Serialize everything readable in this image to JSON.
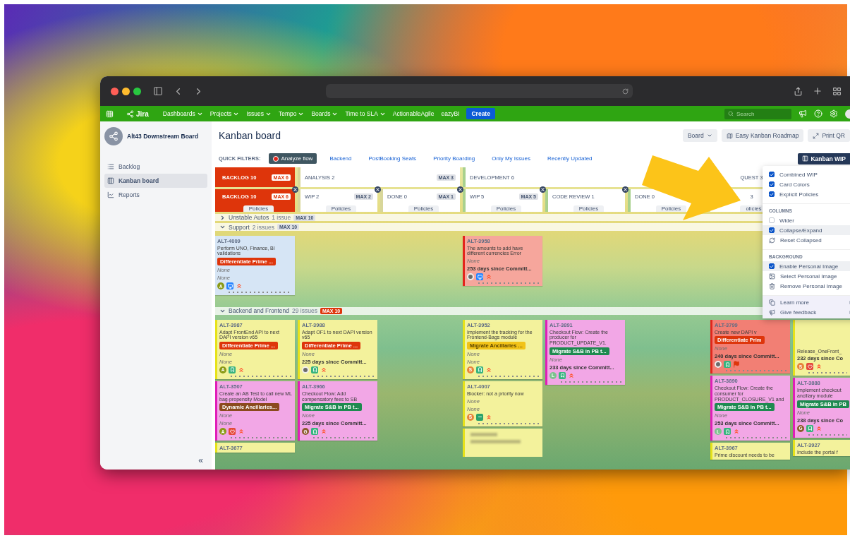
{
  "nav": {
    "product": "Jira",
    "items": [
      {
        "label": "Dashboards",
        "dropdown": true
      },
      {
        "label": "Projects",
        "dropdown": true
      },
      {
        "label": "Issues",
        "dropdown": true
      },
      {
        "label": "Tempo",
        "dropdown": true
      },
      {
        "label": "Boards",
        "dropdown": true
      },
      {
        "label": "Time to SLA",
        "dropdown": true
      },
      {
        "label": "ActionableAgile",
        "dropdown": false
      },
      {
        "label": "eazyBI",
        "dropdown": false
      }
    ],
    "create": "Create",
    "search": {
      "placeholder": "Search"
    }
  },
  "sidebar": {
    "project": "Alt43 Downstream Board",
    "items": [
      {
        "label": "Backlog",
        "kind": "backlog",
        "selected": false
      },
      {
        "label": "Kanban board",
        "kind": "board",
        "selected": true
      },
      {
        "label": "Reports",
        "kind": "reports",
        "selected": false
      }
    ],
    "collapse": "«"
  },
  "header": {
    "title": "Kanban board",
    "buttons": [
      {
        "label": "Board",
        "kind": "menu"
      },
      {
        "label": "Easy Kanban Roadmap",
        "kind": "roadmap"
      },
      {
        "label": "Print QR",
        "kind": "expand"
      }
    ]
  },
  "quick_filters": {
    "label": "QUICK FILTERS:",
    "items": [
      {
        "label": "Analyze flow",
        "selected": true
      },
      {
        "label": "Backend",
        "selected": false
      },
      {
        "label": "PostBooking Seats",
        "selected": false
      },
      {
        "label": "Priority Boarding",
        "selected": false
      },
      {
        "label": "Only My Issues",
        "selected": false
      },
      {
        "label": "Recently Updated",
        "selected": false
      }
    ],
    "wip_button": "Kanban WIP"
  },
  "groups": [
    {
      "label": "BACKLOG 10",
      "max": "MAX 6",
      "kind": "backlog",
      "color": "#de350b",
      "children": [
        {
          "label": "BACKLOG 10",
          "max": "MAX 6",
          "policies": "Policies",
          "collapsible": true
        }
      ]
    },
    {
      "label": "ANALYSIS 2",
      "max": "MAX 3",
      "kind": "normal",
      "color": "#d8d69a",
      "children": [
        {
          "label": "WIP 2",
          "max": "MAX 2",
          "policies": "Policies",
          "collapsible": true
        },
        {
          "label": "DONE 0",
          "max": "MAX 1",
          "policies": "Policies",
          "collapsible": true
        }
      ]
    },
    {
      "label": "DEVELOPMENT 6",
      "kind": "normal",
      "color": "#a9d18e",
      "children": [
        {
          "label": "WIP 5",
          "max": "MAX 5",
          "policies": "Policies",
          "collapsible": true
        },
        {
          "label": "CODE REVIEW 1",
          "policies": "Policies",
          "collapsible": true
        },
        {
          "label": "DONE 0",
          "policies": "Policies",
          "collapsible": true
        }
      ]
    },
    {
      "label": "QUEST 3",
      "kind": "cut",
      "children": [
        {
          "label": "3",
          "policies": "olicies",
          "collapsible": false
        }
      ]
    }
  ],
  "lanes": [
    {
      "name": "Unstable Autos",
      "count": "1 issue",
      "max": "MAX 10",
      "max_exceeded": false,
      "expanded": false
    },
    {
      "name": "Support",
      "count": "2 issues",
      "max": "MAX 10",
      "max_exceeded": false,
      "expanded": true,
      "cells": [
        [
          {
            "kind": "card",
            "key": "ALT-4009",
            "summary": "Perform UNO, Finance, BI validations",
            "epic": {
              "label": "Differentiate Prime ...",
              "color": "#de350b"
            },
            "fields": [
              "None",
              "None"
            ],
            "avatar": {
              "kind": "letter",
              "letter": "A",
              "color": "#8a9a16"
            },
            "issue_type": {
              "kind": "task"
            },
            "priority": {
              "kind": "highest"
            },
            "color": "#d6e5f5"
          }
        ],
        [],
        [],
        [
          {
            "kind": "card",
            "key": "ALT-3958",
            "summary": "The amounts to add have different currencies Error",
            "fields": [
              "None"
            ],
            "days": "253 days since Committ...",
            "avatar": {
              "kind": "photo"
            },
            "issue_type": {
              "kind": "task"
            },
            "priority": {
              "kind": "highest"
            },
            "color": "#f6a69c",
            "stripe": {
              "color": "#e3261c"
            }
          }
        ],
        [],
        [],
        [],
        []
      ]
    },
    {
      "name": "Backend and Frontend",
      "count": "29 issues",
      "max": "MAX 10",
      "max_exceeded": true,
      "expanded": true,
      "cells": [
        [
          {
            "kind": "card",
            "key": "ALT-3987",
            "summary": "Adapt FrontEnd API to next DAPI version v65",
            "epic": {
              "label": "Differentiate Prime ...",
              "color": "#de350b"
            },
            "fields": [
              "None",
              "None"
            ],
            "avatar": {
              "kind": "letter",
              "letter": "A",
              "color": "#8a9a16"
            },
            "issue_type": {
              "kind": "story"
            },
            "priority": {
              "kind": "highest"
            },
            "color": "#f3f29c",
            "stripe": {
              "color": "#e6e21a"
            }
          },
          {
            "kind": "card",
            "key": "ALT-3507",
            "summary": "Create an AB Test to call new ML bag-propensity Model",
            "epic": {
              "label": "Dynamic Ancillaries...",
              "color": "#8b4a1e"
            },
            "fields": [
              "None",
              "None"
            ],
            "avatar": {
              "kind": "letter",
              "letter": "A",
              "color": "#8a9a16"
            },
            "issue_type": {
              "kind": "bug"
            },
            "priority": {
              "kind": "highest"
            },
            "color": "#f2a7e6",
            "stripe": {
              "color": "#e01eb8"
            }
          },
          {
            "kind": "card",
            "key": "ALT-3677",
            "color": "#f3f29c",
            "stripe": {
              "color": "#e6e21a"
            }
          }
        ],
        [
          {
            "kind": "card",
            "key": "ALT-3988",
            "summary": "Adapt OF1 to next DAPI version v65",
            "epic": {
              "label": "Differentiate Prime ...",
              "color": "#de350b"
            },
            "fields": [
              "None"
            ],
            "days": "225 days since Committ...",
            "avatar": {
              "kind": "photo"
            },
            "issue_type": {
              "kind": "story"
            },
            "priority": {
              "kind": "highest"
            },
            "color": "#f3f29c",
            "stripe": {
              "color": "#e6e21a"
            }
          },
          {
            "kind": "card",
            "key": "ALT-3966",
            "summary": "Checkout Flow: Add compensatory fees to SB",
            "epic": {
              "label": "Migrate S&B in PB t...",
              "color": "#1e8a50"
            },
            "fields": [
              "None"
            ],
            "days": "225 days since Committ...",
            "avatar": {
              "kind": "letter",
              "letter": "G",
              "color": "#8b5a2b"
            },
            "issue_type": {
              "kind": "story"
            },
            "priority": {
              "kind": "highest"
            },
            "color": "#f2a7e6",
            "stripe": {
              "color": "#e01eb8"
            }
          }
        ],
        [],
        [
          {
            "kind": "card",
            "key": "ALT-3952",
            "summary": "Implement the tracking for the Frontend-Bags module",
            "epic": {
              "label": "Migrate Ancillaries ...",
              "color": "#f2c318"
            },
            "fields": [
              "None",
              "None"
            ],
            "avatar": {
              "kind": "letter",
              "letter": "S",
              "color": "#e8843a"
            },
            "issue_type": {
              "kind": "story"
            },
            "priority": {
              "kind": "highest"
            },
            "color": "#f3f29c",
            "stripe": {
              "color": "#e6e21a"
            }
          },
          {
            "kind": "card",
            "key": "ALT-4007",
            "summary": "Blocker: not a priority now",
            "fields": [
              "None",
              "None"
            ],
            "avatar": {
              "kind": "letter",
              "letter": "S",
              "color": "#e8843a"
            },
            "issue_type": {
              "kind": "minus"
            },
            "priority": {
              "kind": "highest"
            },
            "color": "#f3f29c",
            "stripe": {
              "color": "#e6e21a"
            }
          },
          {
            "kind": "blurred",
            "color": "#f3f29c",
            "stripe": {
              "color": "#e6e21a"
            }
          }
        ],
        [
          {
            "kind": "card",
            "key": "ALT-3891",
            "summary": "Checkout Flow: Create the producer for PRODUCT_UPDATE_V1.",
            "epic": {
              "label": "Migrate S&B in PB t...",
              "color": "#1e8a50"
            },
            "fields": [
              "None"
            ],
            "days": "233 days since Committ...",
            "avatar": {
              "kind": "letter",
              "letter": "L",
              "color": "#7cc28e"
            },
            "issue_type": {
              "kind": "story"
            },
            "priority": {
              "kind": "highest"
            },
            "color": "#f2a7e6",
            "stripe": {
              "color": "#e01eb8"
            }
          }
        ],
        [],
        [
          {
            "kind": "card",
            "key": "ALT-3799",
            "summary": "Create new DAPI v",
            "epic": {
              "label": "Differentiate Prim",
              "color": "#de350b"
            },
            "fields": [
              "None"
            ],
            "days": "240 days since Committ...",
            "avatar": {
              "kind": "photo"
            },
            "issue_type": {
              "kind": "story"
            },
            "priority": {
              "kind": "blocker"
            },
            "color": "#f27f74",
            "stripe": {
              "color": "#e3261c"
            }
          },
          {
            "kind": "card",
            "key": "ALT-3890",
            "summary": "Checkout Flow: Create the consumer for PRODUCT_CLOSURE_V1 and",
            "epic": {
              "label": "Migrate S&B in PB t...",
              "color": "#1e8a50"
            },
            "fields": [
              "None"
            ],
            "days": "253 days since Committ...",
            "avatar": {
              "kind": "letter",
              "letter": "L",
              "color": "#7cc28e"
            },
            "issue_type": {
              "kind": "story"
            },
            "priority": {
              "kind": "highest"
            },
            "color": "#f2a7e6",
            "stripe": {
              "color": "#e01eb8"
            }
          },
          {
            "kind": "card",
            "key": "ALT-3967",
            "summary": "Prime discount needs to be",
            "color": "#f3f29c",
            "stripe": {
              "color": "#e6e21a"
            }
          }
        ],
        [
          {
            "kind": "card",
            "covered": true,
            "summary": "Release_OneFront_",
            "days": "232 days since Co",
            "avatar": {
              "kind": "letter",
              "letter": "S",
              "color": "#e8843a"
            },
            "issue_type": {
              "kind": "bug"
            },
            "priority": {
              "kind": "highest"
            },
            "color": "#f3f29c",
            "stripe": {
              "color": "#e6e21a"
            }
          },
          {
            "kind": "card",
            "key": "ALT-3888",
            "summary": "Implement checkout ancillary module",
            "epic": {
              "label": "Migrate S&B in PB",
              "color": "#1e8a50"
            },
            "fields": [
              "None"
            ],
            "days": "238 days since Co",
            "avatar": {
              "kind": "letter",
              "letter": "G",
              "color": "#8b5a2b"
            },
            "issue_type": {
              "kind": "story"
            },
            "priority": {
              "kind": "highest"
            },
            "color": "#f2a7e6",
            "stripe": {
              "color": "#e01eb8"
            }
          },
          {
            "kind": "card",
            "key": "ALT-3927",
            "summary": "Include the portal f",
            "color": "#f3f29c",
            "stripe": {
              "color": "#e6e21a"
            }
          }
        ]
      ]
    }
  ],
  "menu": {
    "sections": [
      {
        "items": [
          {
            "label": "Combined WIP",
            "kind": "checkbox",
            "checked": true,
            "highlighted": false
          },
          {
            "label": "Card Colors",
            "kind": "checkbox",
            "checked": true,
            "highlighted": false
          },
          {
            "label": "Explicit Policies",
            "kind": "checkbox",
            "checked": true,
            "highlighted": false
          }
        ]
      },
      {
        "title": "COLUMNS",
        "items": [
          {
            "label": "Wider",
            "kind": "checkbox",
            "checked": false,
            "highlighted": false
          },
          {
            "label": "Collapse/Expand",
            "kind": "checkbox",
            "checked": true,
            "highlighted": true
          },
          {
            "label": "Reset Collapsed",
            "kind": "reset",
            "highlighted": false
          }
        ]
      },
      {
        "title": "BACKGROUND",
        "items": [
          {
            "label": "Enable Personal Image",
            "kind": "checkbox",
            "checked": true,
            "highlighted": true
          },
          {
            "label": "Select Personal Image",
            "kind": "image",
            "highlighted": false
          },
          {
            "label": "Remove Personal Image",
            "kind": "trash",
            "highlighted": false
          }
        ]
      }
    ],
    "footer": [
      {
        "label": "Learn more",
        "kind": "learn"
      },
      {
        "label": "Give feedback",
        "kind": "feedback"
      }
    ]
  }
}
